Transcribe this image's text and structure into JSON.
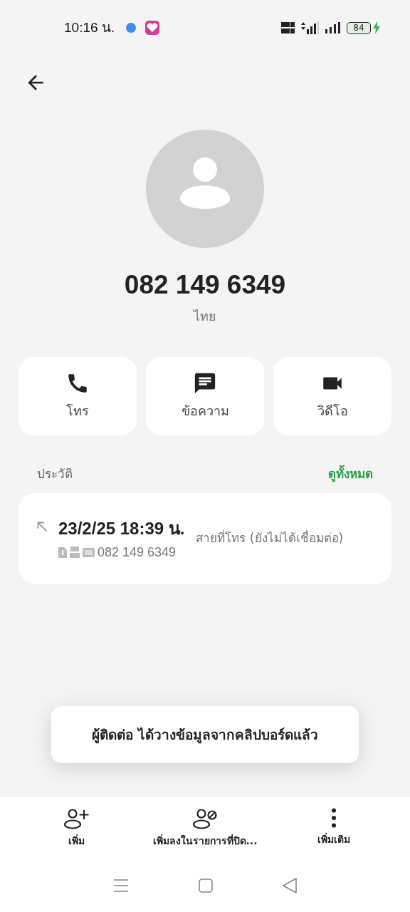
{
  "status_bar": {
    "time": "10:16 น.",
    "battery": "84",
    "charging": true
  },
  "contact": {
    "number": "082 149 6349",
    "location": "ไทย"
  },
  "actions": [
    {
      "kind": "call",
      "label": "โทร"
    },
    {
      "kind": "message",
      "label": "ข้อความ"
    },
    {
      "kind": "video",
      "label": "วิดีโอ"
    }
  ],
  "history": {
    "title": "ประวัติ",
    "see_all": "ดูทั้งหมด",
    "entries": [
      {
        "datetime": "23/2/25 18:39 น.",
        "number": "082 149 6349",
        "status": "สายที่โทร (ยังไม่ได้เชื่อมต่อ)"
      }
    ]
  },
  "toast": "ผู้ติดต่อ ได้วางข้อมูลจากคลิปบอร์ดแล้ว",
  "bottom_actions": [
    {
      "kind": "add",
      "label": "เพิ่ม"
    },
    {
      "kind": "block",
      "label": "เพิ่มลงในรายการที่ปิด..."
    },
    {
      "kind": "more",
      "label": "เพิ่มเติม"
    }
  ]
}
